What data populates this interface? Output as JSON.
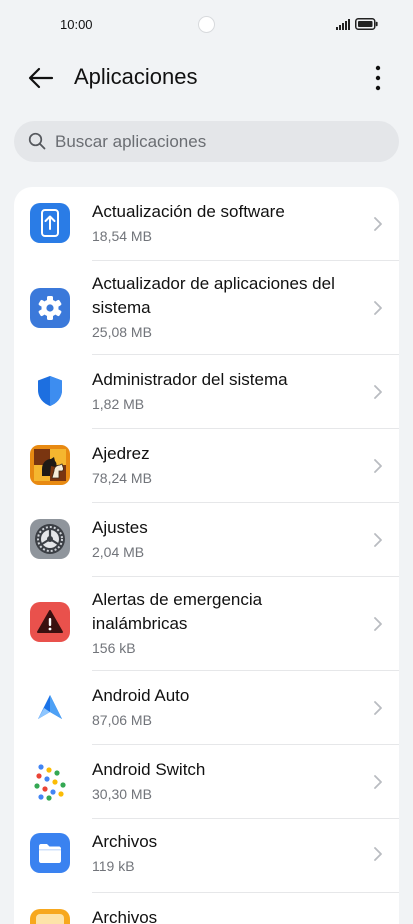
{
  "status_bar": {
    "time": "10:00"
  },
  "header": {
    "title": "Aplicaciones"
  },
  "search": {
    "placeholder": "Buscar aplicaciones"
  },
  "apps": [
    {
      "name": "Actualización de software",
      "size": "18,54 MB",
      "icon": "software-update-icon"
    },
    {
      "name": "Actualizador de aplicaciones del sistema",
      "size": "25,08 MB",
      "icon": "gear-icon"
    },
    {
      "name": "Administrador del sistema",
      "size": "1,82 MB",
      "icon": "shield-icon"
    },
    {
      "name": "Ajedrez",
      "size": "78,24 MB",
      "icon": "chess-icon"
    },
    {
      "name": "Ajustes",
      "size": "2,04 MB",
      "icon": "settings-icon"
    },
    {
      "name": "Alertas de emergencia inalámbricas",
      "size": "156 kB",
      "icon": "warning-icon"
    },
    {
      "name": "Android Auto",
      "size": "87,06 MB",
      "icon": "android-auto-icon"
    },
    {
      "name": "Android Switch",
      "size": "30,30 MB",
      "icon": "android-switch-icon"
    },
    {
      "name": "Archivos",
      "size": "119 kB",
      "icon": "folder-icon"
    },
    {
      "name": "Archivos",
      "size": "",
      "icon": "folder-icon"
    }
  ]
}
